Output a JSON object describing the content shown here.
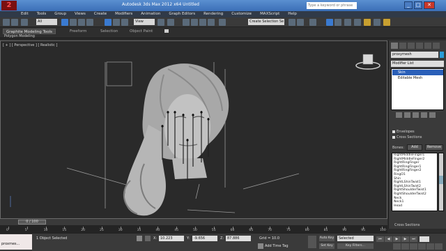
{
  "app": {
    "logo": "2",
    "title": "Autodesk 3ds Max  2012 x64     Untitled",
    "search_placeholder": "Type a keyword or phrase"
  },
  "window_buttons": {
    "minimize": "_",
    "maximize": "□",
    "close": "✕"
  },
  "menu": [
    "Edit",
    "Tools",
    "Group",
    "Views",
    "Create",
    "Modifiers",
    "Animation",
    "Graph Editors",
    "Rendering",
    "Customize",
    "MAXScript",
    "Help"
  ],
  "toolbar": {
    "selection_filter": "All",
    "reference_coord": "View",
    "named_selection": "Create Selection Se"
  },
  "ribbon": {
    "tabs": [
      "Graphite Modeling Tools",
      "Freeform",
      "Selection",
      "Object Paint"
    ],
    "sub_label": "Polygon Modeling"
  },
  "viewport": {
    "label": "[ + ] [ Perspective ] [ Realistic ]"
  },
  "command_panel": {
    "object_name": "proxymesh",
    "modifier_list": "Modifier List",
    "stack": [
      "Skin",
      "Editable Mesh"
    ],
    "checkboxes": [
      "Envelopes",
      "Cross Sections"
    ],
    "bones_label": "Bones:",
    "add_button": "Add",
    "remove_button": "Remove",
    "bones": [
      "RightMiddleFinger1",
      "RightMiddleFinger2",
      "RightRingFinger",
      "RightRingFinger1",
      "RightRingFinger2",
      "RingO1",
      "Shin",
      "RightLShinTwist1",
      "RightLShinTwist2",
      "RightShoulderTwist1",
      "RightShoulderTwist2",
      "Neck",
      "Neck1",
      "Head"
    ],
    "cross_sections": "Cross Sections"
  },
  "time": {
    "slider_label": "0 / 100",
    "ticks": [
      "0",
      "5",
      "10",
      "15",
      "20",
      "25",
      "30",
      "35",
      "40",
      "45",
      "50",
      "55",
      "60",
      "65",
      "70",
      "75",
      "80",
      "85",
      "90",
      "95",
      "100"
    ]
  },
  "status": {
    "maxscript": "proxmes...",
    "selection": "1 Object Selected",
    "x_label": "X:",
    "x_value": "10.223",
    "y_label": "Y:",
    "y_value": "-9.656",
    "z_label": "Z:",
    "z_value": "87.886",
    "grid": "Grid = 10.0",
    "add_time_tag": "Add Time Tag",
    "auto_key": "Auto Key",
    "set_key": "Set Key",
    "selected": "Selected",
    "key_filters": "Key Filters..."
  }
}
